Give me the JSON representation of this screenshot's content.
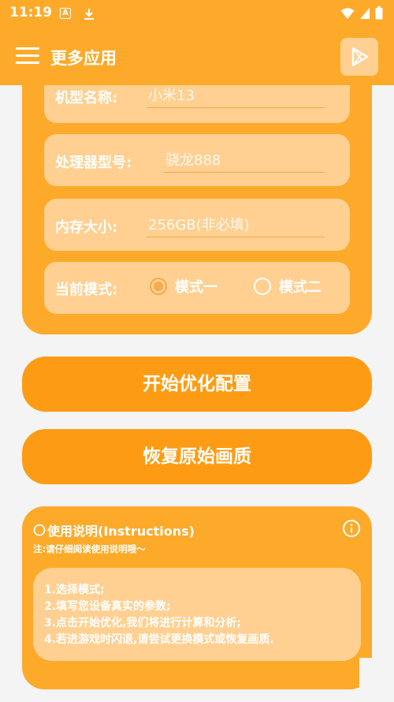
{
  "status_bar": {
    "time": "11:19",
    "icons": [
      "a-notification-icon",
      "download-icon",
      "wifi-icon",
      "signal-icon",
      "battery-icon"
    ]
  },
  "app_bar": {
    "title": "更多应用",
    "menu_icon": "hamburger-menu-icon",
    "action_icon": "play-store-icon"
  },
  "form": {
    "model": {
      "label": "机型名称:",
      "placeholder": "小米13"
    },
    "processor": {
      "label": "处理器型号:",
      "placeholder": "骁龙888"
    },
    "memory": {
      "label": "内存大小:",
      "placeholder": "256GB(非必填)"
    },
    "mode": {
      "label": "当前模式:",
      "options": [
        "模式一",
        "模式二"
      ],
      "selected": "模式一"
    }
  },
  "buttons": {
    "start": "开始优化配置",
    "restore": "恢复原始画质"
  },
  "instructions": {
    "title": "使用说明(Instructions)",
    "subtitle": "注:请仔细阅读使用说明哦～",
    "lines": [
      "1.选择模式;",
      "2.填写您设备真实的参数;",
      "3.点击开始优化,我们将进行计算和分析;",
      "4.若进游戏时闪退,请尝试更换模式或恢复画质."
    ]
  },
  "colors": {
    "primary": "#fdaa2b",
    "button": "#fd9c14",
    "field_bg": "#ffd091",
    "radio_accent": "#f7a94c",
    "background": "#f4f4f4"
  }
}
